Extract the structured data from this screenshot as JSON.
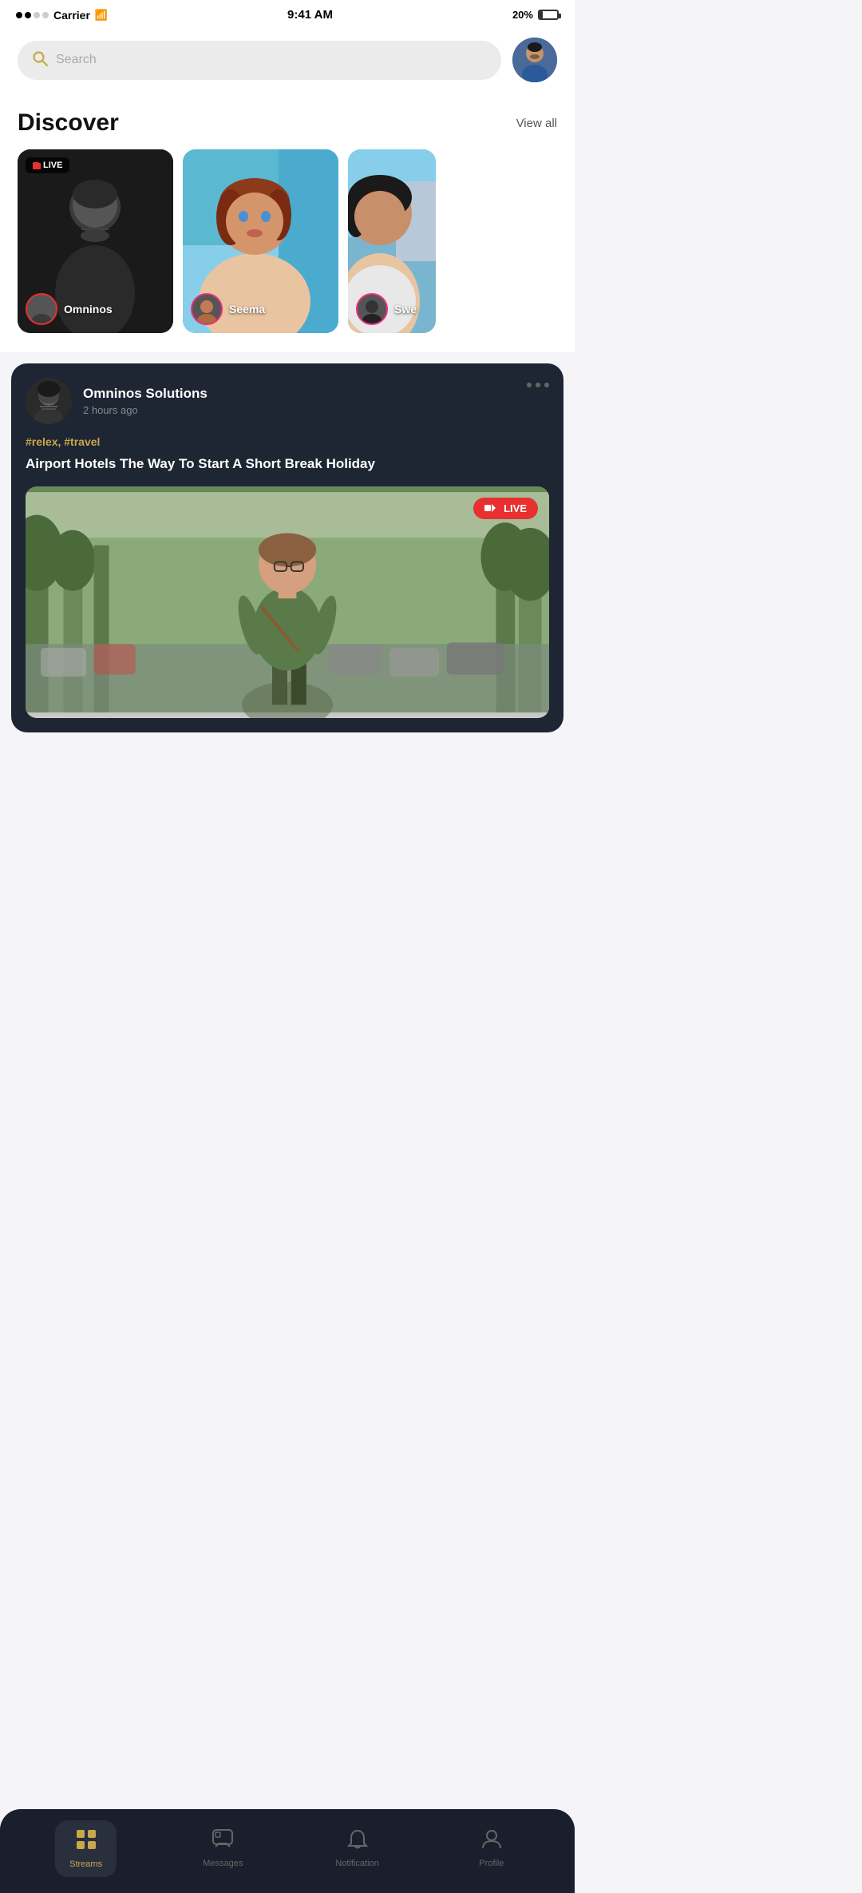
{
  "statusBar": {
    "carrier": "Carrier",
    "time": "9:41 AM",
    "battery": "20%"
  },
  "header": {
    "searchPlaceholder": "Search",
    "searchIconLabel": "search-icon"
  },
  "discover": {
    "title": "Discover",
    "viewAll": "View all",
    "cards": [
      {
        "id": "card-1",
        "liveBadge": "LIVE",
        "userName": "Omninos",
        "hasLive": true
      },
      {
        "id": "card-2",
        "liveBadge": null,
        "userName": "Seema",
        "hasLive": false
      },
      {
        "id": "card-3",
        "liveBadge": null,
        "userName": "Swe",
        "hasLive": false
      }
    ]
  },
  "post": {
    "userName": "Omninos Solutions",
    "timeAgo": "2 hours ago",
    "tags": "#relex, #travel",
    "title": "Airport Hotels The Way To Start A Short Break Holiday",
    "liveBadge": "LIVE",
    "hasLive": true
  },
  "bottomNav": {
    "items": [
      {
        "id": "streams",
        "label": "Streams",
        "icon": "⊞",
        "active": true
      },
      {
        "id": "messages",
        "label": "Messages",
        "icon": "💬",
        "active": false
      },
      {
        "id": "notification",
        "label": "Notification",
        "icon": "🔔",
        "active": false
      },
      {
        "id": "profile",
        "label": "Profile",
        "icon": "👤",
        "active": false
      }
    ]
  }
}
